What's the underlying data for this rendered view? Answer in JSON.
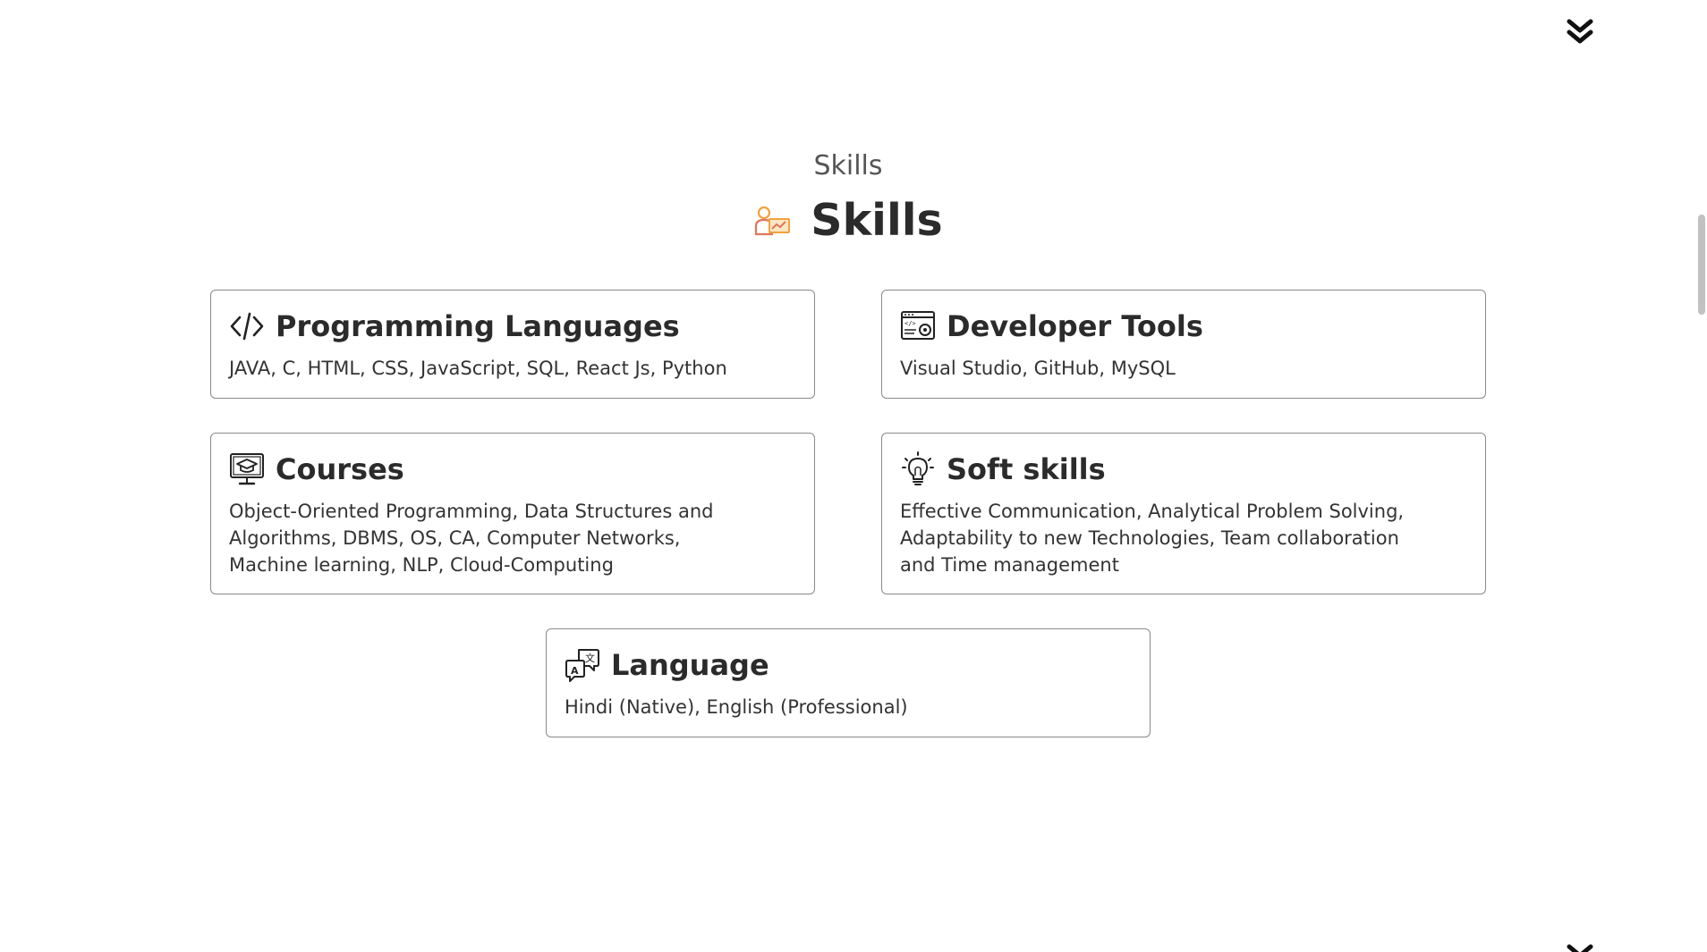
{
  "section": {
    "subtitle": "Skills",
    "title": "Skills",
    "title_icon": "skills-person-icon"
  },
  "cards": [
    {
      "title": "Programming Languages",
      "icon": "code-icon",
      "text": "JAVA, C, HTML, CSS, JavaScript, SQL, React Js, Python"
    },
    {
      "title": "Developer Tools",
      "icon": "dev-tools-icon",
      "text": "Visual Studio, GitHub, MySQL"
    },
    {
      "title": "Courses",
      "icon": "graduation-monitor-icon",
      "text": "Object-Oriented Programming, Data Structures and Algorithms, DBMS, OS, CA, Computer Networks, Machine learning, NLP, Cloud-Computing"
    },
    {
      "title": "Soft skills",
      "icon": "lightbulb-icon",
      "text": "Effective Communication, Analytical Problem Solving, Adaptability to new Technologies, Team collaboration and Time management"
    },
    {
      "title": "Language",
      "icon": "translate-icon",
      "text": "Hindi (Native), English (Professional)"
    }
  ],
  "nav": {
    "scroll_down_icon": "double-chevron-down-icon"
  },
  "colors": {
    "title_icon_orange": "#f4a13a",
    "border": "#8a8a8a",
    "text": "#2b2b2b"
  }
}
